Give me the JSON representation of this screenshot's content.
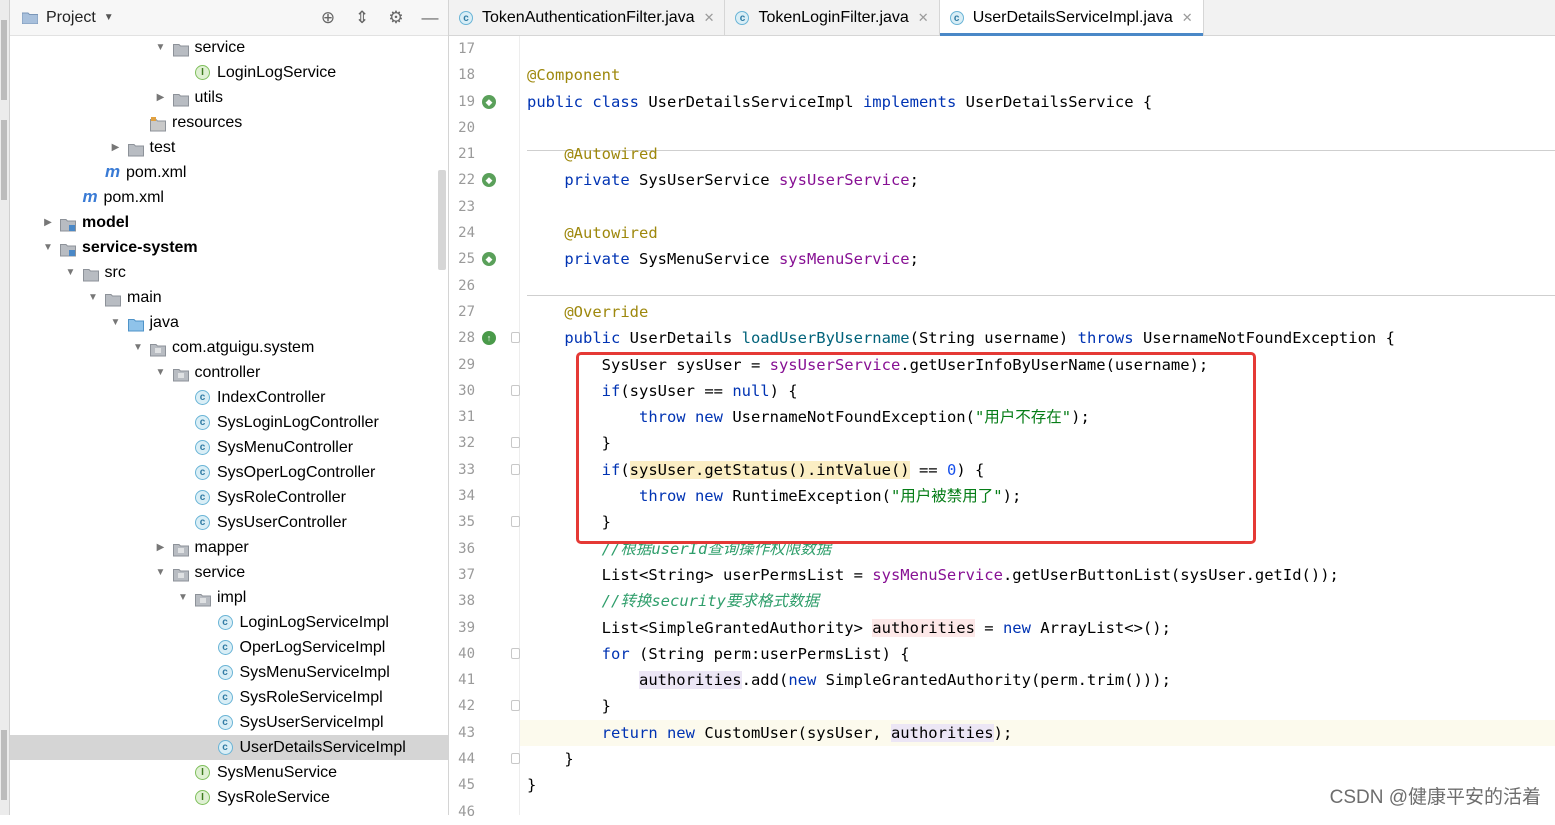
{
  "project_panel": {
    "title": "Project",
    "tree": [
      {
        "depth": 7,
        "icon": "folder",
        "label": "service",
        "arrow": "down"
      },
      {
        "depth": 8,
        "icon": "interface",
        "label": "LoginLogService"
      },
      {
        "depth": 7,
        "icon": "folder",
        "label": "utils",
        "arrow": "right"
      },
      {
        "depth": 6,
        "icon": "resources",
        "label": "resources"
      },
      {
        "depth": 5,
        "icon": "folder",
        "label": "test",
        "arrow": "right"
      },
      {
        "depth": 4,
        "icon": "maven",
        "label": "pom.xml"
      },
      {
        "depth": 3,
        "icon": "maven",
        "label": "pom.xml"
      },
      {
        "depth": 2,
        "icon": "module",
        "label": "model",
        "arrow": "right",
        "bold": true
      },
      {
        "depth": 2,
        "icon": "module",
        "label": "service-system",
        "arrow": "down",
        "bold": true
      },
      {
        "depth": 3,
        "icon": "folder",
        "label": "src",
        "arrow": "down"
      },
      {
        "depth": 4,
        "icon": "folder",
        "label": "main",
        "arrow": "down"
      },
      {
        "depth": 5,
        "icon": "source-folder",
        "label": "java",
        "arrow": "down"
      },
      {
        "depth": 6,
        "icon": "package",
        "label": "com.atguigu.system",
        "arrow": "down"
      },
      {
        "depth": 7,
        "icon": "package",
        "label": "controller",
        "arrow": "down"
      },
      {
        "depth": 8,
        "icon": "class",
        "label": "IndexController"
      },
      {
        "depth": 8,
        "icon": "class",
        "label": "SysLoginLogController"
      },
      {
        "depth": 8,
        "icon": "class",
        "label": "SysMenuController"
      },
      {
        "depth": 8,
        "icon": "class",
        "label": "SysOperLogController"
      },
      {
        "depth": 8,
        "icon": "class",
        "label": "SysRoleController"
      },
      {
        "depth": 8,
        "icon": "class",
        "label": "SysUserController"
      },
      {
        "depth": 7,
        "icon": "package",
        "label": "mapper",
        "arrow": "right"
      },
      {
        "depth": 7,
        "icon": "package",
        "label": "service",
        "arrow": "down"
      },
      {
        "depth": 8,
        "icon": "package",
        "label": "impl",
        "arrow": "down"
      },
      {
        "depth": 9,
        "icon": "class",
        "label": "LoginLogServiceImpl"
      },
      {
        "depth": 9,
        "icon": "class",
        "label": "OperLogServiceImpl"
      },
      {
        "depth": 9,
        "icon": "class",
        "label": "SysMenuServiceImpl"
      },
      {
        "depth": 9,
        "icon": "class",
        "label": "SysRoleServiceImpl"
      },
      {
        "depth": 9,
        "icon": "class",
        "label": "SysUserServiceImpl"
      },
      {
        "depth": 9,
        "icon": "class",
        "label": "UserDetailsServiceImpl",
        "selected": true
      },
      {
        "depth": 8,
        "icon": "interface",
        "label": "SysMenuService"
      },
      {
        "depth": 8,
        "icon": "interface",
        "label": "SysRoleService"
      }
    ]
  },
  "tabs": [
    {
      "label": "TokenAuthenticationFilter.java",
      "active": false
    },
    {
      "label": "TokenLoginFilter.java",
      "active": false
    },
    {
      "label": "UserDetailsServiceImpl.java",
      "active": true
    }
  ],
  "editor": {
    "lines": [
      {
        "n": "17",
        "tokens": []
      },
      {
        "n": "18",
        "tokens": [
          {
            "t": "@Component",
            "c": "ann"
          }
        ]
      },
      {
        "n": "19",
        "mark": "bean",
        "tokens": [
          {
            "t": "public class ",
            "c": "kw"
          },
          {
            "t": "UserDetailsServiceImpl "
          },
          {
            "t": "implements ",
            "c": "kw"
          },
          {
            "t": "UserDetailsService {"
          }
        ]
      },
      {
        "n": "20",
        "tokens": []
      },
      {
        "n": "21",
        "tokens": [
          {
            "t": "    "
          },
          {
            "t": "@Autowired",
            "c": "ann"
          }
        ]
      },
      {
        "n": "22",
        "mark": "bean",
        "tokens": [
          {
            "t": "    "
          },
          {
            "t": "private ",
            "c": "kw"
          },
          {
            "t": "SysUserService "
          },
          {
            "t": "sysUserService",
            "c": "fld"
          },
          {
            "t": ";"
          }
        ]
      },
      {
        "n": "23",
        "tokens": []
      },
      {
        "n": "24",
        "tokens": [
          {
            "t": "    "
          },
          {
            "t": "@Autowired",
            "c": "ann"
          }
        ]
      },
      {
        "n": "25",
        "mark": "bean",
        "tokens": [
          {
            "t": "    "
          },
          {
            "t": "private ",
            "c": "kw"
          },
          {
            "t": "SysMenuService "
          },
          {
            "t": "sysMenuService",
            "c": "fld"
          },
          {
            "t": ";"
          }
        ]
      },
      {
        "n": "26",
        "tokens": []
      },
      {
        "n": "27",
        "tokens": [
          {
            "t": "    "
          },
          {
            "t": "@Override",
            "c": "ann"
          }
        ]
      },
      {
        "n": "28",
        "mark": "override",
        "fold": true,
        "tokens": [
          {
            "t": "    "
          },
          {
            "t": "public ",
            "c": "kw"
          },
          {
            "t": "UserDetails "
          },
          {
            "t": "loadUserByUsername",
            "c": "mth"
          },
          {
            "t": "(String username) "
          },
          {
            "t": "throws ",
            "c": "kw"
          },
          {
            "t": "UsernameNotFoundException {"
          }
        ]
      },
      {
        "n": "29",
        "tokens": [
          {
            "t": "        SysUser sysUser = "
          },
          {
            "t": "sysUserService",
            "c": "fld"
          },
          {
            "t": ".getUserInfoByUserName(username);"
          }
        ]
      },
      {
        "n": "30",
        "fold": true,
        "tokens": [
          {
            "t": "        "
          },
          {
            "t": "if",
            "c": "kw"
          },
          {
            "t": "(sysUser == "
          },
          {
            "t": "null",
            "c": "kw"
          },
          {
            "t": ") {"
          }
        ]
      },
      {
        "n": "31",
        "tokens": [
          {
            "t": "            "
          },
          {
            "t": "throw new ",
            "c": "kw"
          },
          {
            "t": "UsernameNotFoundException("
          },
          {
            "t": "\"用户不存在\"",
            "c": "str"
          },
          {
            "t": ");"
          }
        ]
      },
      {
        "n": "32",
        "fold": true,
        "tokens": [
          {
            "t": "        }"
          }
        ]
      },
      {
        "n": "33",
        "fold": true,
        "tokens": [
          {
            "t": "        "
          },
          {
            "t": "if",
            "c": "kw"
          },
          {
            "t": "("
          },
          {
            "t": "sysUser.getStatus().intValue()",
            "c": "hl-yellow"
          },
          {
            "t": " == "
          },
          {
            "t": "0",
            "c": "num"
          },
          {
            "t": ") {"
          }
        ]
      },
      {
        "n": "34",
        "tokens": [
          {
            "t": "            "
          },
          {
            "t": "throw new ",
            "c": "kw"
          },
          {
            "t": "RuntimeException("
          },
          {
            "t": "\"用户被禁用了\"",
            "c": "str"
          },
          {
            "t": ");"
          }
        ]
      },
      {
        "n": "35",
        "fold": true,
        "tokens": [
          {
            "t": "        }"
          }
        ]
      },
      {
        "n": "36",
        "tokens": [
          {
            "t": "        "
          },
          {
            "t": "//根据userId查询操作权限数据",
            "c": "cmt-green"
          }
        ]
      },
      {
        "n": "37",
        "tokens": [
          {
            "t": "        List<String> userPermsList = "
          },
          {
            "t": "sysMenuService",
            "c": "fld"
          },
          {
            "t": ".getUserButtonList(sysUser.getId());"
          }
        ]
      },
      {
        "n": "38",
        "tokens": [
          {
            "t": "        "
          },
          {
            "t": "//转换security要求格式数据",
            "c": "cmt-green"
          }
        ]
      },
      {
        "n": "39",
        "tokens": [
          {
            "t": "        List<SimpleGrantedAuthority> "
          },
          {
            "t": "authorities",
            "c": "hl-read"
          },
          {
            "t": " = "
          },
          {
            "t": "new ",
            "c": "kw"
          },
          {
            "t": "ArrayList<>();"
          }
        ]
      },
      {
        "n": "40",
        "fold": true,
        "tokens": [
          {
            "t": "        "
          },
          {
            "t": "for ",
            "c": "kw"
          },
          {
            "t": "(String perm:userPermsList) {"
          }
        ]
      },
      {
        "n": "41",
        "tokens": [
          {
            "t": "            "
          },
          {
            "t": "authorities",
            "c": "hl-ref"
          },
          {
            "t": ".add("
          },
          {
            "t": "new ",
            "c": "kw"
          },
          {
            "t": "SimpleGrantedAuthority(perm.trim()));"
          }
        ]
      },
      {
        "n": "42",
        "fold": true,
        "tokens": [
          {
            "t": "        }"
          }
        ]
      },
      {
        "n": "43",
        "current": true,
        "tokens": [
          {
            "t": "        "
          },
          {
            "t": "return new ",
            "c": "kw"
          },
          {
            "t": "CustomUser(sysUser, "
          },
          {
            "t": "authorities",
            "c": "hl-ref"
          },
          {
            "t": ");"
          }
        ]
      },
      {
        "n": "44",
        "fold": true,
        "tokens": [
          {
            "t": "    }"
          }
        ]
      },
      {
        "n": "45",
        "tokens": [
          {
            "t": "}"
          }
        ]
      },
      {
        "n": "46",
        "tokens": []
      }
    ]
  },
  "watermark": "CSDN @健康平安的活着"
}
